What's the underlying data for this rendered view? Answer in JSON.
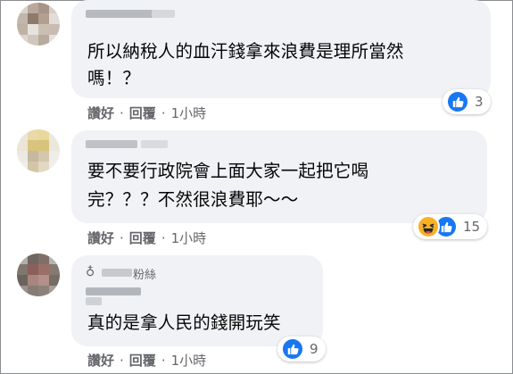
{
  "comments": [
    {
      "text_line1": "所以納稅人的血汗錢拿來浪費是理所當然",
      "text_line2": "嗎！？",
      "reaction_count": "3",
      "reactions": [
        "like-icon"
      ],
      "actions": {
        "like": "讚好",
        "reply": "回覆",
        "time": "1小時"
      }
    },
    {
      "text_line1": "要不要行政院會上面大家一起把它喝",
      "text_line2": "完？？？不然很浪費耶～～",
      "reaction_count": "15",
      "reactions": [
        "haha-icon",
        "like-icon"
      ],
      "actions": {
        "like": "讚好",
        "reply": "回覆",
        "time": "1小時"
      }
    },
    {
      "author_partial": "粉絲",
      "text_line1": "真的是拿人民的錢開玩笑",
      "reaction_count": "9",
      "reactions": [
        "like-icon"
      ],
      "actions": {
        "like": "讚好",
        "reply": "回覆",
        "time": "1小時"
      }
    }
  ],
  "colors": {
    "bubble": "#f0f2f5",
    "meta_text": "#65676b",
    "body_text": "#050505",
    "like_blue": "#1877f2",
    "haha_yellow": "#f7b125"
  }
}
